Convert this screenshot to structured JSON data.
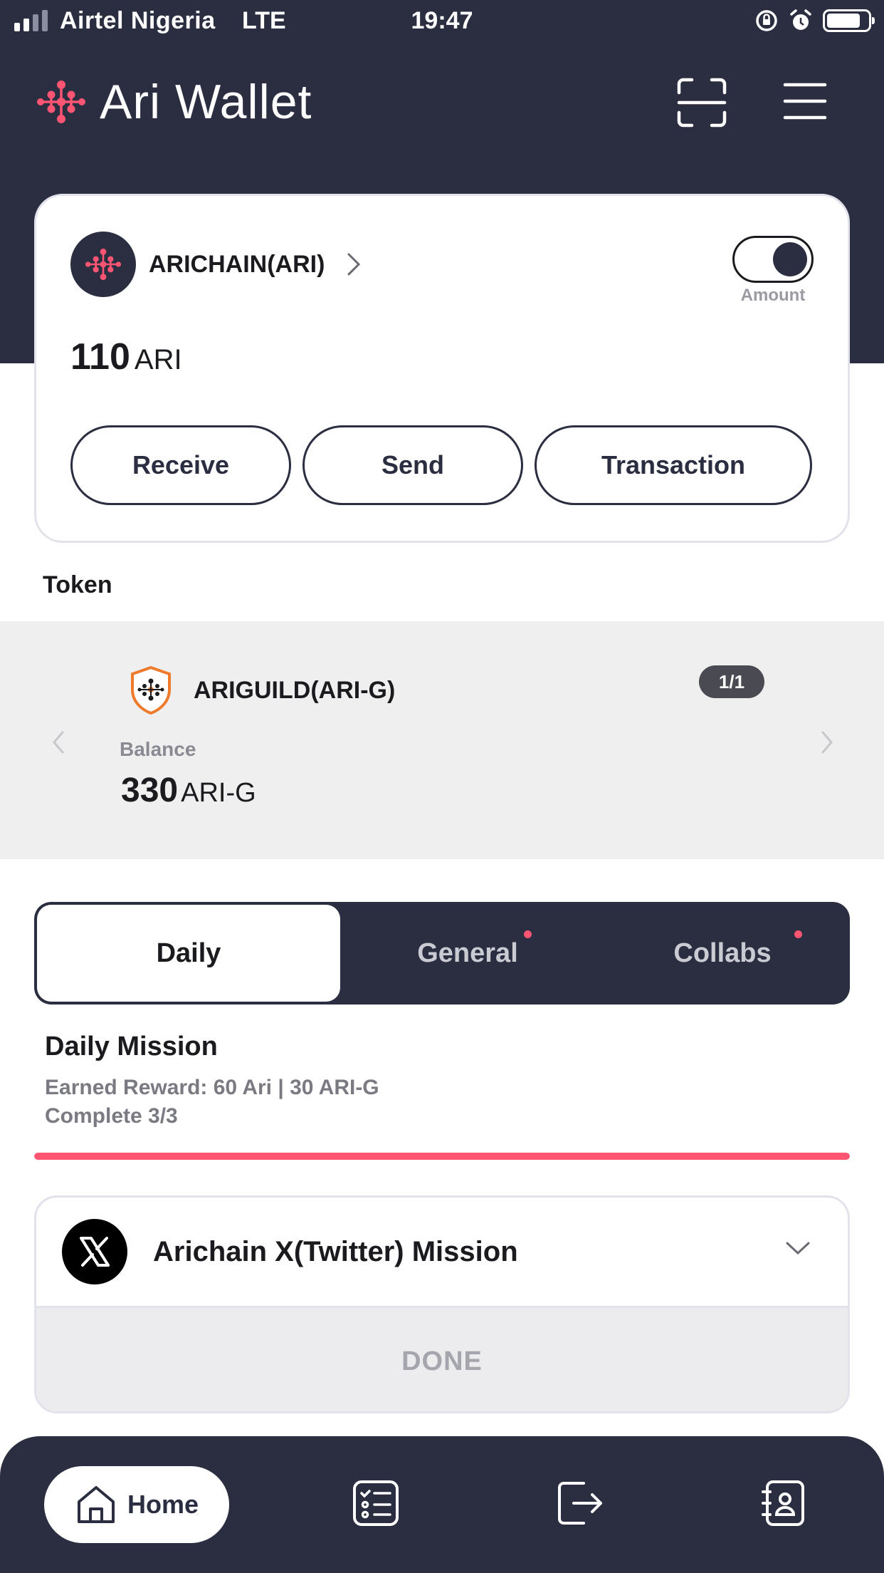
{
  "status_bar": {
    "carrier": "Airtel Nigeria",
    "network": "LTE",
    "time": "19:47",
    "icons": [
      "signal-icon",
      "rotation-lock-icon",
      "alarm-icon",
      "battery-icon"
    ]
  },
  "app_bar": {
    "title": "Ari Wallet",
    "icons": [
      "ari-logo-icon",
      "scan-icon",
      "menu-icon"
    ]
  },
  "wallet_card": {
    "chain_name": "ARICHAIN(ARI)",
    "toggle_label": "Amount",
    "toggle_on": true,
    "balance_value": "110",
    "balance_unit": "ARI",
    "actions": {
      "receive": "Receive",
      "send": "Send",
      "transaction": "Transaction"
    }
  },
  "token_section": {
    "label": "Token",
    "token_name": "ARIGUILD(ARI-G)",
    "page_indicator": "1/1",
    "balance_label": "Balance",
    "balance_value": "330",
    "balance_unit": "ARI-G"
  },
  "tabs": [
    {
      "label": "Daily",
      "active": true,
      "has_dot": false
    },
    {
      "label": "General",
      "active": false,
      "has_dot": true
    },
    {
      "label": "Collabs",
      "active": false,
      "has_dot": true
    }
  ],
  "mission": {
    "title": "Daily Mission",
    "reward": "Earned Reward: 60 Ari | 30 ARI-G",
    "complete": "Complete 3/3",
    "progress_fraction": 1.0,
    "card": {
      "name": "Arichain X(Twitter) Mission",
      "status": "DONE"
    }
  },
  "bottom_nav": {
    "home_label": "Home",
    "items": [
      "home-icon",
      "task-list-icon",
      "exit-icon",
      "contacts-icon"
    ]
  },
  "colors": {
    "header_bg": "#2a2e40",
    "accent_pink": "#ff5573",
    "token_panel_bg": "#efeff0"
  }
}
